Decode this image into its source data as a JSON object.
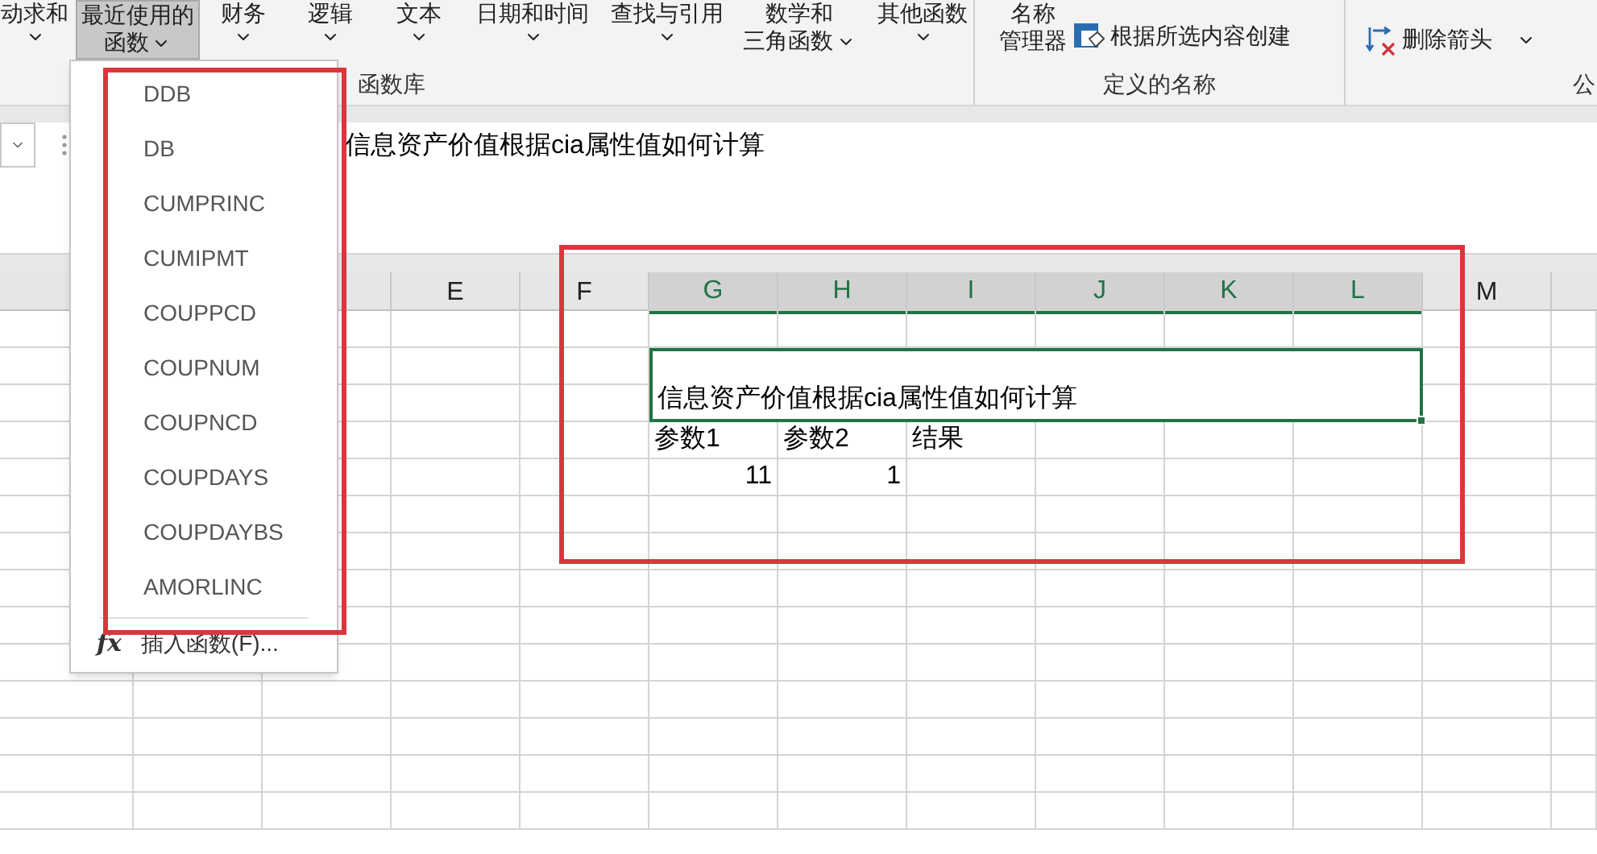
{
  "ribbon": {
    "buttons": [
      {
        "line1": "动求和",
        "dropdown": true,
        "selected": false
      },
      {
        "line1": "最近使用的",
        "line2": "函数",
        "dropdown": true,
        "selected": true
      },
      {
        "line1": "财务",
        "dropdown": true,
        "selected": false
      },
      {
        "line1": "逻辑",
        "dropdown": true,
        "selected": false
      },
      {
        "line1": "文本",
        "dropdown": true,
        "selected": false
      },
      {
        "line1": "日期和时间",
        "dropdown": true,
        "selected": false
      },
      {
        "line1": "查找与引用",
        "dropdown": true,
        "selected": false
      },
      {
        "line1": "数学和",
        "line2": "三角函数",
        "dropdown": true,
        "selected": false
      },
      {
        "line1": "其他函数",
        "dropdown": true,
        "selected": false
      }
    ],
    "group_1_label": "函数库",
    "name_manager": {
      "line1": "名称",
      "line2": "管理器"
    },
    "create_from_selection": "根据所选内容创建",
    "group_2_label": "定义的名称",
    "remove_arrows": "删除箭头",
    "group_3_label": "公"
  },
  "formula_bar": {
    "content": "信息资产价值根据cia属性值如何计算"
  },
  "function_menu": {
    "items": [
      "DDB",
      "DB",
      "CUMPRINC",
      "CUMIPMT",
      "COUPPCD",
      "COUPNUM",
      "COUPNCD",
      "COUPDAYS",
      "COUPDAYBS",
      "AMORLINC"
    ],
    "footer_icon": "fx",
    "footer": "插入函数(F)..."
  },
  "sheet": {
    "columns": [
      {
        "label": "E",
        "selected": false
      },
      {
        "label": "F",
        "selected": false
      },
      {
        "label": "G",
        "selected": true
      },
      {
        "label": "H",
        "selected": true
      },
      {
        "label": "I",
        "selected": true
      },
      {
        "label": "J",
        "selected": true
      },
      {
        "label": "K",
        "selected": true
      },
      {
        "label": "L",
        "selected": true
      },
      {
        "label": "M",
        "selected": false
      }
    ],
    "merged_cell": "信息资产价值根据cia属性值如何计算",
    "header_row": [
      "参数1",
      "参数2",
      "结果"
    ],
    "value_row": [
      "11",
      "1"
    ]
  }
}
